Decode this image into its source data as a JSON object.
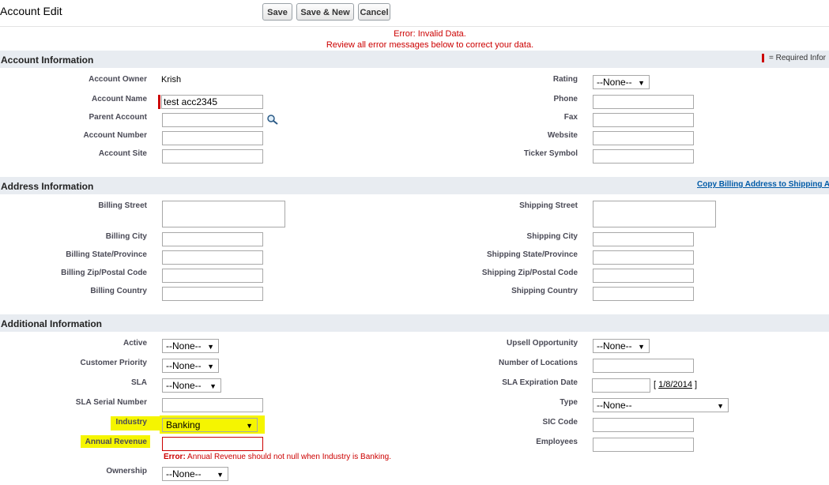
{
  "header": {
    "title": "Account Edit",
    "save_label": "Save",
    "save_new_label": "Save & New",
    "cancel_label": "Cancel"
  },
  "errors": {
    "line1": "Error: Invalid Data.",
    "line2": "Review all error messages below to correct your data."
  },
  "account_info": {
    "section_title": "Account Information",
    "required_legend": "= Required Infor",
    "account_owner_label": "Account Owner",
    "account_owner_value": "Krish",
    "account_name_label": "Account Name",
    "account_name_value": "test acc2345",
    "parent_account_label": "Parent Account",
    "account_number_label": "Account Number",
    "account_site_label": "Account Site",
    "rating_label": "Rating",
    "rating_value": "--None--",
    "phone_label": "Phone",
    "fax_label": "Fax",
    "website_label": "Website",
    "ticker_label": "Ticker Symbol"
  },
  "address_info": {
    "section_title": "Address Information",
    "copy_link": "Copy Billing Address to Shipping A",
    "billing_street_label": "Billing Street",
    "billing_city_label": "Billing City",
    "billing_state_label": "Billing State/Province",
    "billing_zip_label": "Billing Zip/Postal Code",
    "billing_country_label": "Billing Country",
    "shipping_street_label": "Shipping Street",
    "shipping_city_label": "Shipping City",
    "shipping_state_label": "Shipping State/Province",
    "shipping_zip_label": "Shipping Zip/Postal Code",
    "shipping_country_label": "Shipping Country"
  },
  "additional_info": {
    "section_title": "Additional Information",
    "active_label": "Active",
    "active_value": "--None--",
    "priority_label": "Customer Priority",
    "priority_value": "--None--",
    "sla_label": "SLA",
    "sla_value": "--None--",
    "sla_serial_label": "SLA Serial Number",
    "industry_label": "Industry",
    "industry_value": "Banking",
    "annual_revenue_label": "Annual Revenue",
    "annual_revenue_error_prefix": "Error:",
    "annual_revenue_error": "Annual Revenue should not null when Industry is Banking.",
    "ownership_label": "Ownership",
    "ownership_value": "--None--",
    "upsell_label": "Upsell Opportunity",
    "upsell_value": "--None--",
    "locations_label": "Number of Locations",
    "sla_expiration_label": "SLA Expiration Date",
    "sla_expiration_bracket_open": "[",
    "sla_expiration_date_link": "1/8/2014",
    "sla_expiration_bracket_close": "]",
    "type_label": "Type",
    "type_value": "--None--",
    "sic_label": "SIC Code",
    "employees_label": "Employees"
  },
  "colors": {
    "error": "#cc0000",
    "section_bg": "#e8ecf1",
    "highlight": "#f5f500",
    "link": "#015ba7"
  }
}
